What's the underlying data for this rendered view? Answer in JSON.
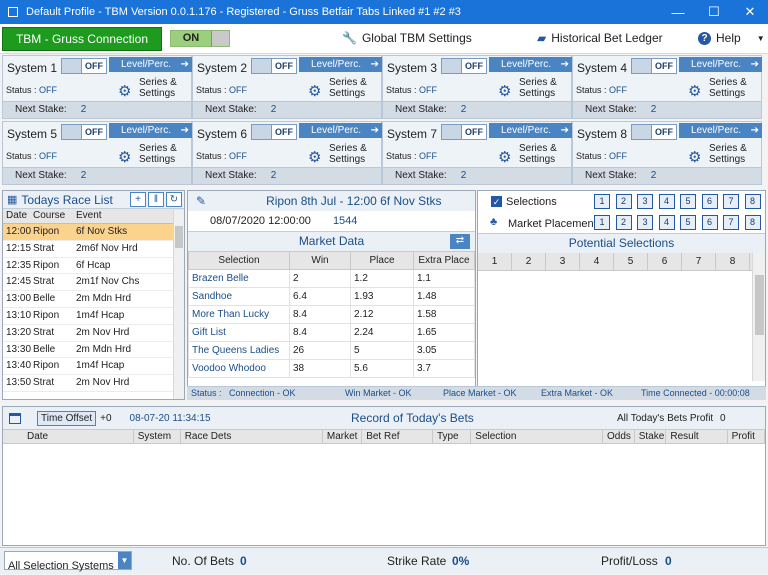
{
  "window": {
    "title": "Default Profile  - TBM Version 0.0.1.176 - Registered - Gruss Betfair Tabs Linked #1 #2 #3",
    "minimize": "—",
    "maximize": "☐",
    "close": "✕"
  },
  "toolbar": {
    "connection": "TBM - Gruss Connection",
    "toggle": "ON",
    "global_settings": "Global TBM Settings",
    "ledger": "Historical Bet Ledger",
    "help": "Help"
  },
  "systems": [
    {
      "name": "System 1",
      "toggle": "OFF",
      "mode": "Level/Perc.",
      "status_label": "Status : ",
      "status": "OFF",
      "series": "Series &",
      "settings": "Settings",
      "next_label": "Next Stake:",
      "next": "2"
    },
    {
      "name": "System 2",
      "toggle": "OFF",
      "mode": "Level/Perc.",
      "status_label": "Status : ",
      "status": "OFF",
      "series": "Series &",
      "settings": "Settings",
      "next_label": "Next Stake:",
      "next": "2"
    },
    {
      "name": "System 3",
      "toggle": "OFF",
      "mode": "Level/Perc.",
      "status_label": "Status : ",
      "status": "OFF",
      "series": "Series &",
      "settings": "Settings",
      "next_label": "Next Stake:",
      "next": "2"
    },
    {
      "name": "System 4",
      "toggle": "OFF",
      "mode": "Level/Perc.",
      "status_label": "Status : ",
      "status": "OFF",
      "series": "Series &",
      "settings": "Settings",
      "next_label": "Next Stake:",
      "next": "2"
    },
    {
      "name": "System 5",
      "toggle": "OFF",
      "mode": "Level/Perc.",
      "status_label": "Status : ",
      "status": "OFF",
      "series": "Series &",
      "settings": "Settings",
      "next_label": "Next Stake:",
      "next": "2"
    },
    {
      "name": "System 6",
      "toggle": "OFF",
      "mode": "Level/Perc.",
      "status_label": "Status : ",
      "status": "OFF",
      "series": "Series &",
      "settings": "Settings",
      "next_label": "Next Stake:",
      "next": "2"
    },
    {
      "name": "System 7",
      "toggle": "OFF",
      "mode": "Level/Perc.",
      "status_label": "Status : ",
      "status": "OFF",
      "series": "Series &",
      "settings": "Settings",
      "next_label": "Next Stake:",
      "next": "2"
    },
    {
      "name": "System 8",
      "toggle": "OFF",
      "mode": "Level/Perc.",
      "status_label": "Status : ",
      "status": "OFF",
      "series": "Series &",
      "settings": "Settings",
      "next_label": "Next Stake:",
      "next": "2"
    }
  ],
  "race_list": {
    "title": "Todays Race List",
    "headers": [
      "Date",
      "Course",
      "Event"
    ],
    "rows": [
      [
        "12:00",
        "Ripon",
        "6f Nov Stks"
      ],
      [
        "12:15",
        "Strat",
        "2m6f Nov Hrd"
      ],
      [
        "12:35",
        "Ripon",
        "6f Hcap"
      ],
      [
        "12:45",
        "Strat",
        "2m1f Nov Chs"
      ],
      [
        "13:00",
        "Belle",
        "2m Mdn Hrd"
      ],
      [
        "13:10",
        "Ripon",
        "1m4f Hcap"
      ],
      [
        "13:20",
        "Strat",
        "2m Nov Hrd"
      ],
      [
        "13:30",
        "Belle",
        "2m Mdn Hrd"
      ],
      [
        "13:40",
        "Ripon",
        "1m4f Hcap"
      ],
      [
        "13:50",
        "Strat",
        "2m Nov Hrd"
      ]
    ]
  },
  "market": {
    "title": "Ripon  8th Jul - 12:00 6f Nov Stks",
    "datetime": "08/07/2020 12:00:00",
    "id": "1544",
    "data_title": "Market Data",
    "headers": [
      "Selection",
      "Win",
      "Place",
      "Extra Place"
    ],
    "rows": [
      [
        "Brazen Belle",
        "2",
        "1.2",
        "1.1"
      ],
      [
        "Sandhoe",
        "6.4",
        "1.93",
        "1.48"
      ],
      [
        "More Than Lucky",
        "8.4",
        "2.12",
        "1.58"
      ],
      [
        "Gift List",
        "8.4",
        "2.24",
        "1.65"
      ],
      [
        "The Queens Ladies",
        "26",
        "5",
        "3.05"
      ],
      [
        "Voodoo Whodoo",
        "38",
        "5.6",
        "3.7"
      ]
    ]
  },
  "selections": {
    "selections_label": "Selections",
    "placement_label": "Market Placement",
    "numbers": [
      "1",
      "2",
      "3",
      "4",
      "5",
      "6",
      "7",
      "8"
    ],
    "title": "Potential Selections",
    "headers": [
      "1",
      "2",
      "3",
      "4",
      "5",
      "6",
      "7",
      "8"
    ]
  },
  "status": {
    "label": "Status :",
    "connection": "Connection - OK",
    "win": "Win Market - OK",
    "place": "Place Market - OK",
    "extra": "Extra Market - OK",
    "time": "Time Connected - 00:00:08"
  },
  "bets": {
    "time_offset": "Time Offset",
    "offset_value": "+0",
    "timestamp": "08-07-20 11:34:15",
    "title": "Record of Today's Bets",
    "profit_label": "All Today's Bets Profit",
    "profit": "0",
    "headers": [
      "Date",
      "System",
      "Race Dets",
      "Market",
      "Bet Ref",
      "Type",
      "Selection",
      "Odds",
      "Stake",
      "Result",
      "Profit"
    ]
  },
  "footer": {
    "filter": "All Selection Systems",
    "bets_label": "No. Of Bets",
    "bets": "0",
    "strike_label": "Strike Rate",
    "strike": "0%",
    "pl_label": "Profit/Loss",
    "pl": "0"
  }
}
